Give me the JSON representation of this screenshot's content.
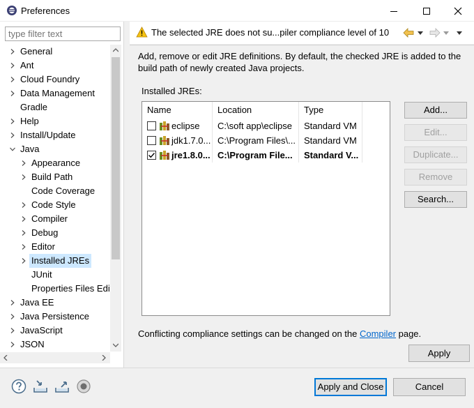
{
  "window": {
    "title": "Preferences"
  },
  "filter": {
    "placeholder": "type filter text"
  },
  "tree": [
    {
      "label": "General",
      "depth": 0,
      "expander": "collapsed"
    },
    {
      "label": "Ant",
      "depth": 0,
      "expander": "collapsed"
    },
    {
      "label": "Cloud Foundry",
      "depth": 0,
      "expander": "collapsed"
    },
    {
      "label": "Data Management",
      "depth": 0,
      "expander": "collapsed"
    },
    {
      "label": "Gradle",
      "depth": 0,
      "expander": "none"
    },
    {
      "label": "Help",
      "depth": 0,
      "expander": "collapsed"
    },
    {
      "label": "Install/Update",
      "depth": 0,
      "expander": "collapsed"
    },
    {
      "label": "Java",
      "depth": 0,
      "expander": "expanded"
    },
    {
      "label": "Appearance",
      "depth": 1,
      "expander": "collapsed"
    },
    {
      "label": "Build Path",
      "depth": 1,
      "expander": "collapsed"
    },
    {
      "label": "Code Coverage",
      "depth": 1,
      "expander": "none"
    },
    {
      "label": "Code Style",
      "depth": 1,
      "expander": "collapsed"
    },
    {
      "label": "Compiler",
      "depth": 1,
      "expander": "collapsed"
    },
    {
      "label": "Debug",
      "depth": 1,
      "expander": "collapsed"
    },
    {
      "label": "Editor",
      "depth": 1,
      "expander": "collapsed"
    },
    {
      "label": "Installed JREs",
      "depth": 1,
      "expander": "collapsed",
      "selected": true
    },
    {
      "label": "JUnit",
      "depth": 1,
      "expander": "none"
    },
    {
      "label": "Properties Files Edit",
      "depth": 1,
      "expander": "none"
    },
    {
      "label": "Java EE",
      "depth": 0,
      "expander": "collapsed"
    },
    {
      "label": "Java Persistence",
      "depth": 0,
      "expander": "collapsed"
    },
    {
      "label": "JavaScript",
      "depth": 0,
      "expander": "collapsed"
    },
    {
      "label": "JSON",
      "depth": 0,
      "expander": "collapsed"
    }
  ],
  "header": {
    "message": "The selected JRE does not su...piler compliance level of 10",
    "icon": "warning-icon"
  },
  "page": {
    "description": "Add, remove or edit JRE definitions. By default, the checked JRE is added to the build path of newly created Java projects.",
    "installed_label": "Installed JREs:",
    "columns": [
      "Name",
      "Location",
      "Type"
    ],
    "rows": [
      {
        "name": "eclipse",
        "location": "C:\\soft app\\eclipse",
        "type": "Standard VM",
        "checked": false,
        "bold": false
      },
      {
        "name": "jdk1.7.0...",
        "location": "C:\\Program Files\\...",
        "type": "Standard VM",
        "checked": false,
        "bold": false
      },
      {
        "name": "jre1.8.0...",
        "location": "C:\\Program File...",
        "type": "Standard V...",
        "checked": true,
        "bold": true
      }
    ],
    "buttons": [
      {
        "label": "Add...",
        "enabled": true
      },
      {
        "label": "Edit...",
        "enabled": false
      },
      {
        "label": "Duplicate...",
        "enabled": false
      },
      {
        "label": "Remove",
        "enabled": false
      },
      {
        "label": "Search...",
        "enabled": true
      }
    ],
    "conflict_prefix": "Conflicting compliance settings can be changed on the ",
    "conflict_link": "Compiler",
    "conflict_suffix": " page.",
    "apply_label": "Apply"
  },
  "footer": {
    "apply_close": "Apply and Close",
    "cancel": "Cancel"
  },
  "colors": {
    "accent": "#0078d7",
    "selection": "#cde8ff",
    "link": "#0066cc",
    "warning": "#f5c211"
  }
}
